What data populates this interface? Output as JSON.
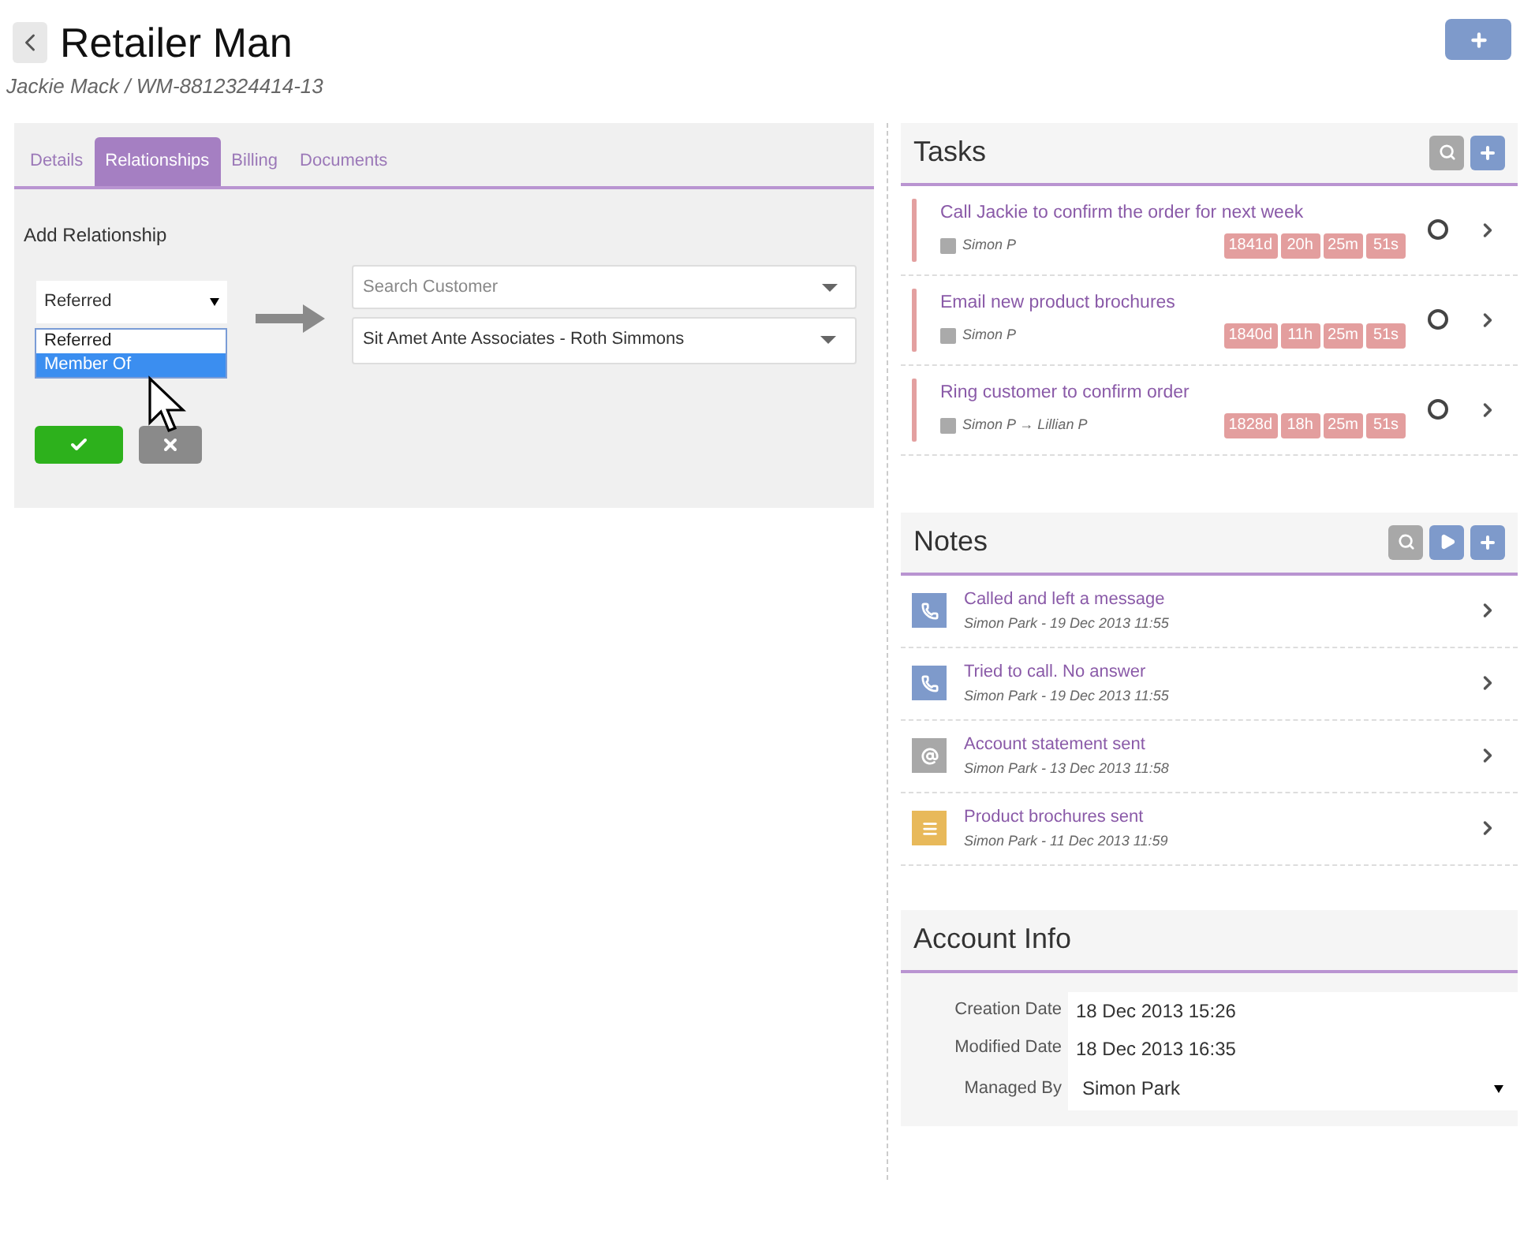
{
  "header": {
    "title": "Retailer Man",
    "subtitle": "Jackie Mack / WM-8812324414-13"
  },
  "tabs": [
    {
      "label": "Details",
      "selected": false
    },
    {
      "label": "Relationships",
      "selected": true
    },
    {
      "label": "Billing",
      "selected": false
    },
    {
      "label": "Documents",
      "selected": false
    }
  ],
  "relationship": {
    "heading": "Add Relationship",
    "type_value": "Referred",
    "type_options": [
      {
        "label": "Referred",
        "selected": false
      },
      {
        "label": "Member Of",
        "selected": true
      }
    ],
    "search": {
      "placeholder": "Search Customer"
    },
    "customer": "Sit Amet Ante Associates - Roth Simmons"
  },
  "tasks": {
    "title": "Tasks",
    "items": [
      {
        "title": "Call Jackie to confirm the order for next week",
        "assignee": "Simon P",
        "timer": [
          "1841d",
          "20h",
          "25m",
          "51s"
        ],
        "done": false
      },
      {
        "title": "Email new product brochures",
        "assignee": "Simon P",
        "timer": [
          "1840d",
          "11h",
          "25m",
          "51s"
        ],
        "done": false
      },
      {
        "title": "Ring customer to confirm order",
        "assignee": "Simon P → Lillian P",
        "timer": [
          "1828d",
          "18h",
          "25m",
          "51s"
        ],
        "done": false
      }
    ]
  },
  "notes": {
    "title": "Notes",
    "items": [
      {
        "kind": "call",
        "title": "Called and left a message",
        "meta": "Simon Park - 19 Dec 2013 11:55"
      },
      {
        "kind": "call",
        "title": "Tried to call. No answer",
        "meta": "Simon Park - 19 Dec 2013 11:55"
      },
      {
        "kind": "email",
        "title": "Account statement sent",
        "meta": "Simon Park - 13 Dec 2013 11:58"
      },
      {
        "kind": "document",
        "title": "Product brochures sent",
        "meta": "Simon Park - 11 Dec 2013 11:59"
      }
    ]
  },
  "account_info": {
    "title": "Account Info",
    "fields": [
      {
        "kind": "text",
        "label": "Creation Date",
        "value": "18 Dec 2013 15:26"
      },
      {
        "kind": "text",
        "label": "Modified Date",
        "value": "18 Dec 2013 16:35"
      },
      {
        "kind": "select",
        "label": "Managed By",
        "value": "Simon Park"
      }
    ]
  }
}
